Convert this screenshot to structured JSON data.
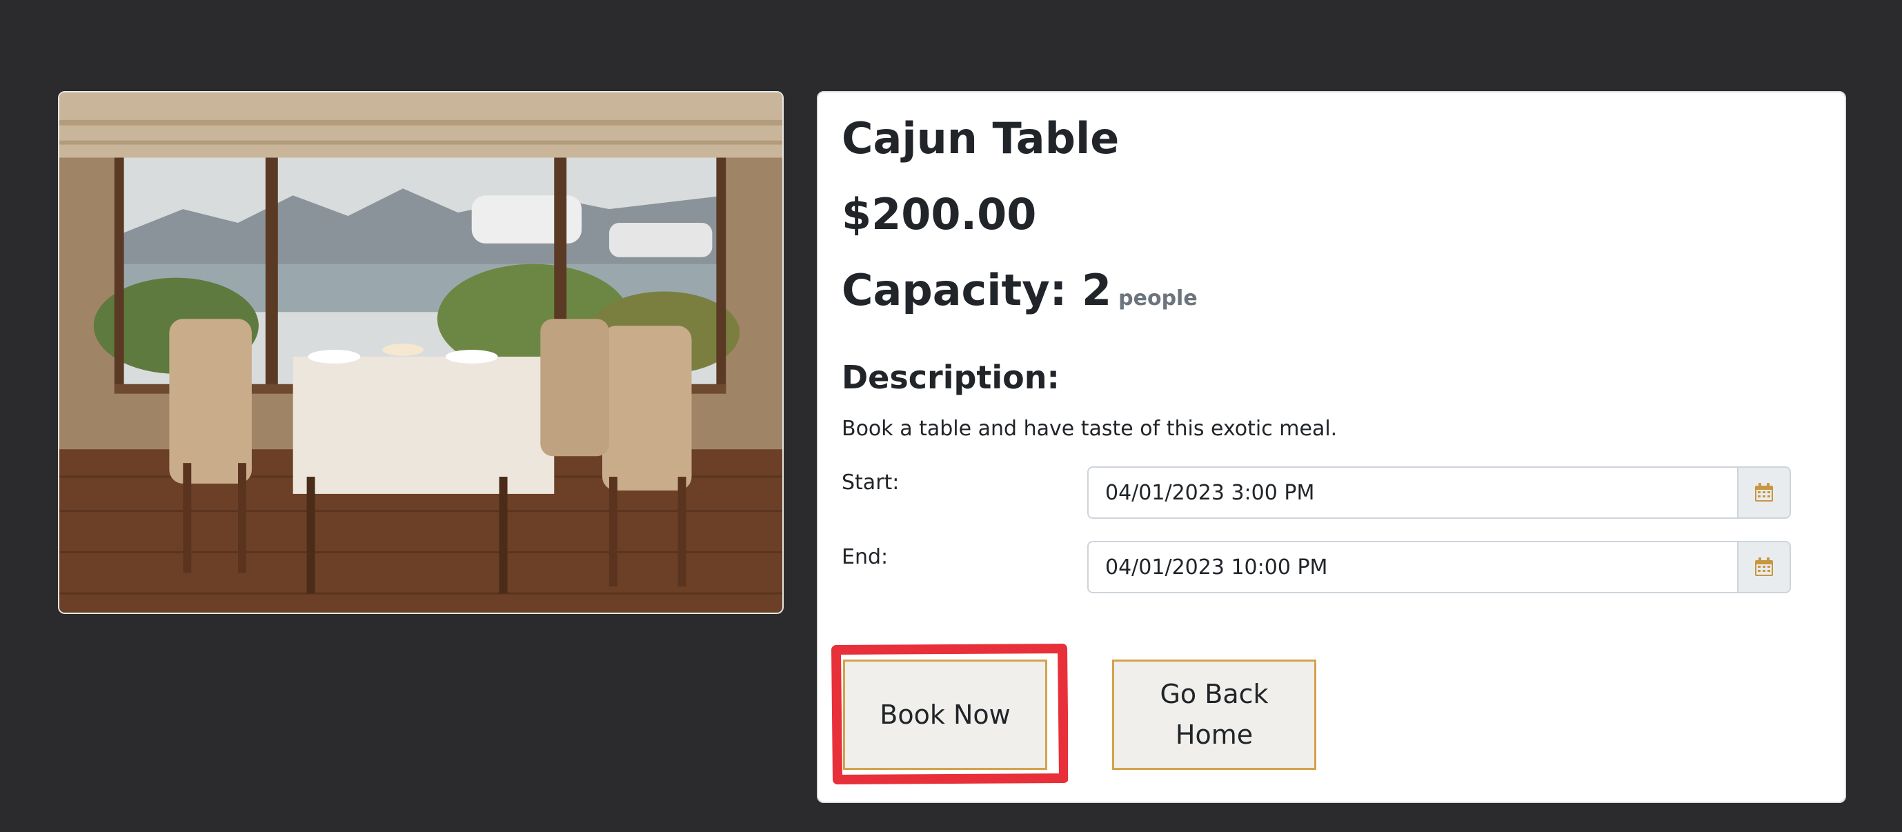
{
  "listing": {
    "title": "Cajun Table",
    "price": "$200.00",
    "capacity_label": "Capacity: 2",
    "capacity_unit": "people",
    "description_heading": "Description:",
    "description_text": "Book a table and have taste of this exotic meal."
  },
  "booking": {
    "start_label": "Start:",
    "start_value": "04/01/2023 3:00 PM",
    "end_label": "End:",
    "end_value": "04/01/2023 10:00 PM"
  },
  "actions": {
    "book_label": "Book Now",
    "home_label": "Go Back Home"
  },
  "icons": {
    "calendar": "calendar-icon"
  },
  "colors": {
    "page_background": "#2b2b2d",
    "accent": "#d4a24c",
    "highlight": "#e8303a"
  }
}
